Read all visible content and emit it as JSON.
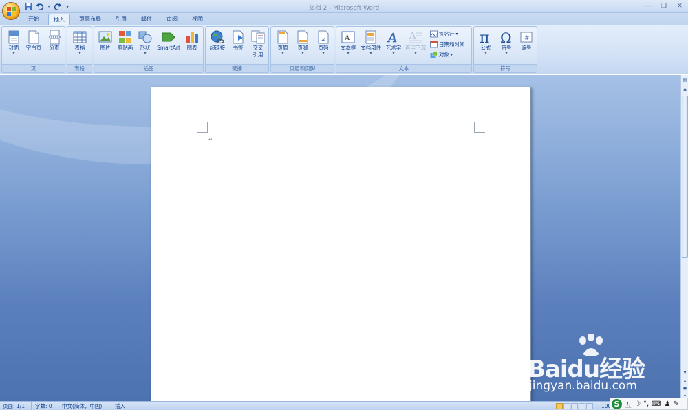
{
  "window": {
    "title": "文档 2 - Microsoft Word"
  },
  "quick_access": {
    "save_icon": "save-icon",
    "undo_icon": "undo-icon",
    "redo_icon": "redo-icon",
    "customize_icon": "chevron-down-icon"
  },
  "tabs": [
    {
      "label": "开始"
    },
    {
      "label": "插入",
      "active": true
    },
    {
      "label": "页面布局"
    },
    {
      "label": "引用"
    },
    {
      "label": "邮件"
    },
    {
      "label": "审阅"
    },
    {
      "label": "视图"
    }
  ],
  "ribbon": {
    "groups": {
      "pages": {
        "label": "页",
        "buttons": [
          "封面",
          "空白页",
          "分页"
        ]
      },
      "tables": {
        "label": "表格",
        "buttons": [
          "表格"
        ]
      },
      "illustrations": {
        "label": "插图",
        "buttons": [
          "图片",
          "剪贴画",
          "形状",
          "SmartArt",
          "图表"
        ]
      },
      "links": {
        "label": "链接",
        "buttons": [
          "超链接",
          "书签",
          "交叉",
          "引用"
        ]
      },
      "header_footer": {
        "label": "页眉和页脚",
        "buttons": [
          "页眉",
          "页脚",
          "页码"
        ]
      },
      "text": {
        "label": "文本",
        "buttons": [
          "文本框",
          "文档部件",
          "艺术字",
          "首字下沉"
        ],
        "small_buttons": [
          "签名行",
          "日期和时间",
          "对象"
        ]
      },
      "symbols": {
        "label": "符号",
        "buttons": [
          "公式",
          "符号",
          "编号"
        ]
      }
    }
  },
  "status_bar": {
    "page": "页面: 1/1",
    "words": "字数: 0",
    "language": "中文(简体，中国)",
    "mode": "插入",
    "zoom": "100%"
  },
  "watermark": {
    "text": "Baidu经验",
    "url": "jingyan.baidu.com"
  },
  "ime": {
    "logo": "S",
    "mode": "五"
  },
  "colors": {
    "ribbon_bg": "#dbe7f7",
    "workspace": "#6b8fc8",
    "text": "#15428b",
    "office_orange": "#f7b32b"
  }
}
